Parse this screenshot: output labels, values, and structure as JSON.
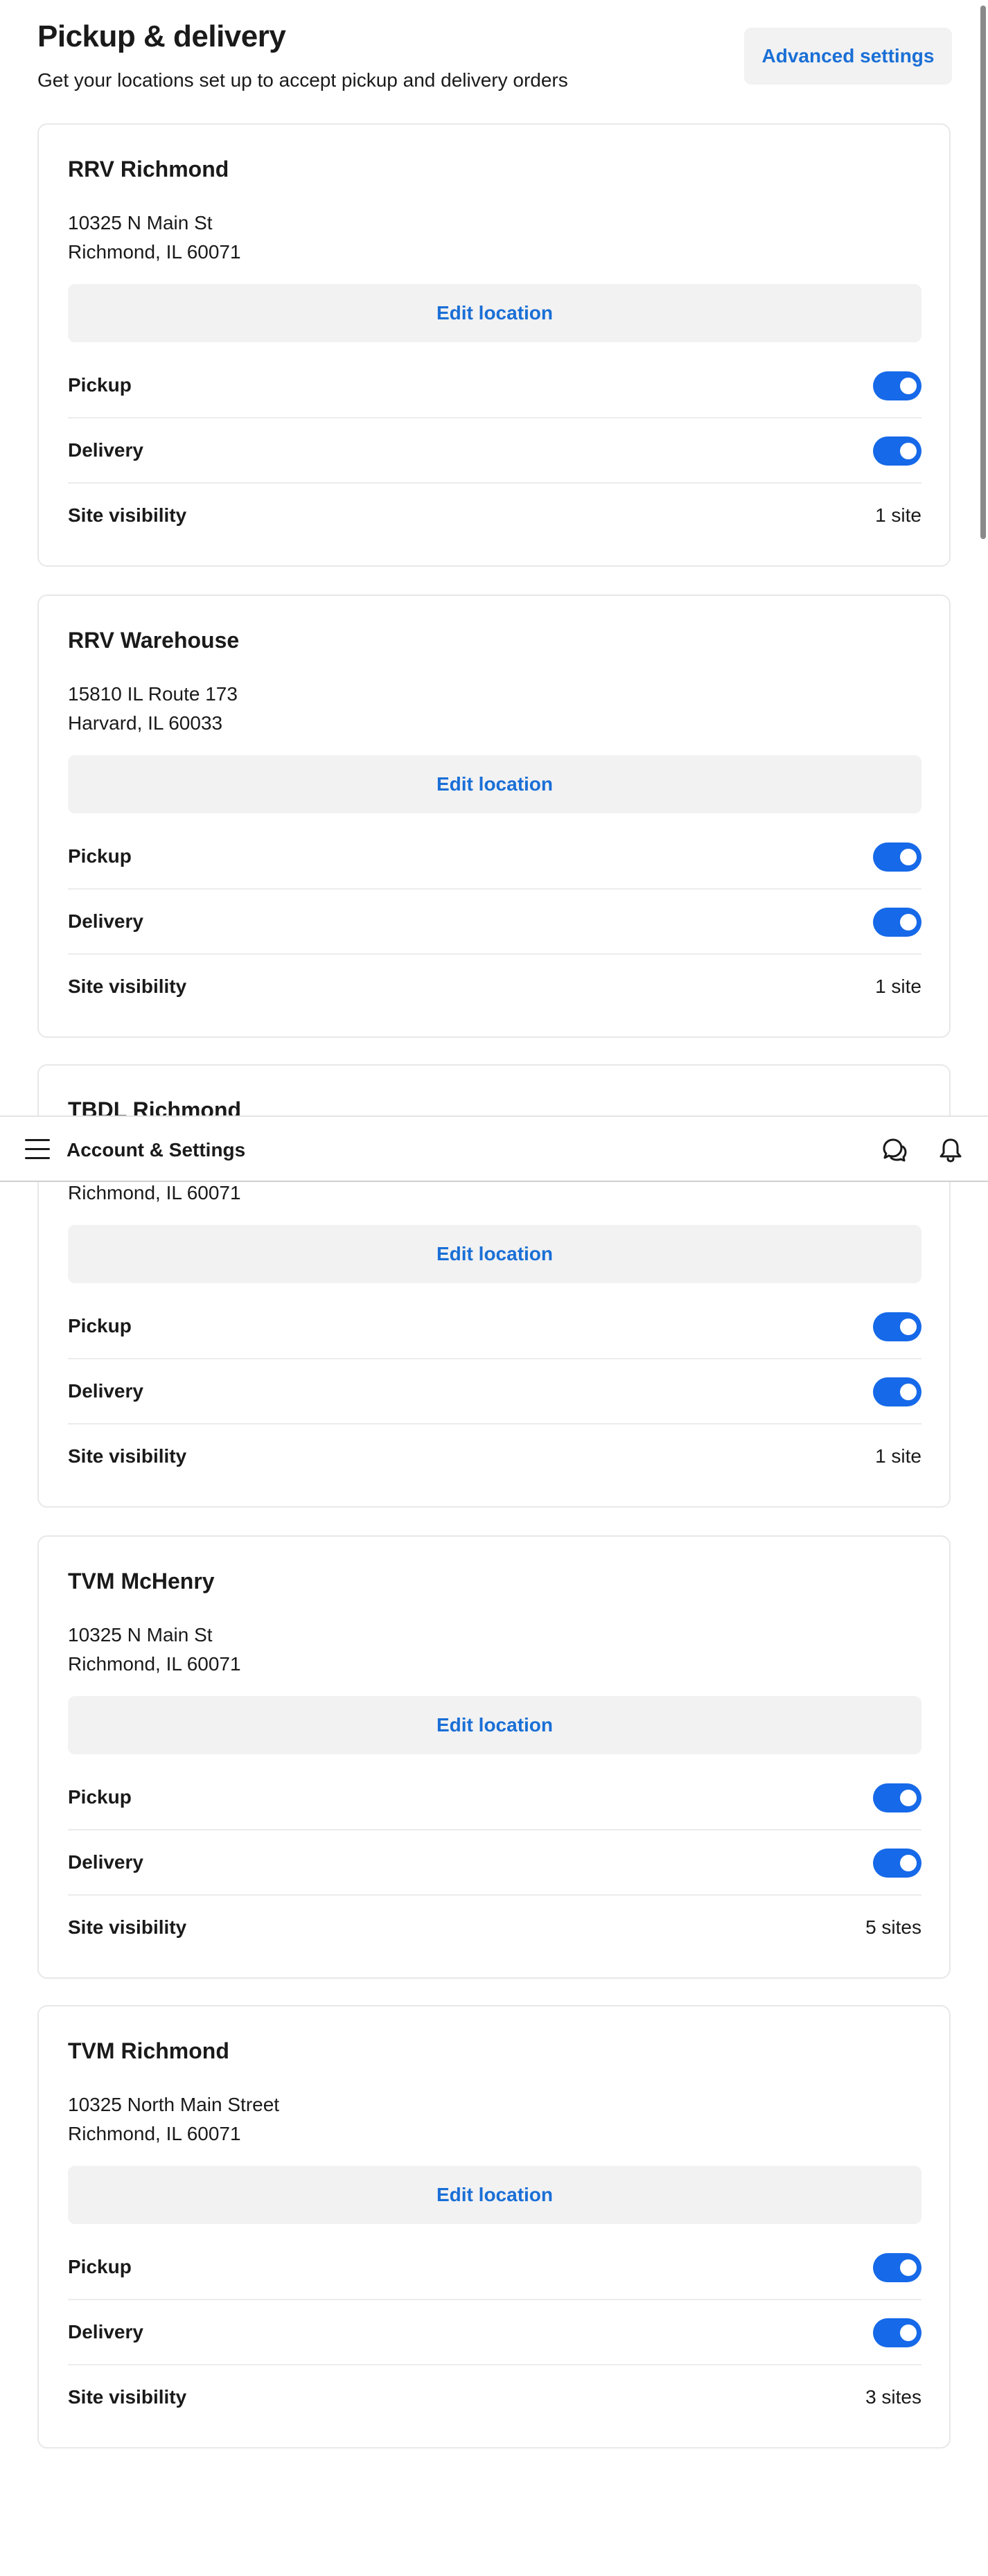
{
  "header": {
    "title": "Pickup & delivery",
    "subtitle": "Get your locations set up to accept pickup and delivery orders",
    "advanced_settings_label": "Advanced settings"
  },
  "labels": {
    "edit_location": "Edit location",
    "pickup": "Pickup",
    "delivery": "Delivery",
    "site_visibility": "Site visibility"
  },
  "locations": [
    {
      "name": "RRV Richmond",
      "address_line1": "10325 N Main St",
      "address_line2": "Richmond, IL 60071",
      "pickup_enabled": true,
      "delivery_enabled": true,
      "site_visibility": "1 site"
    },
    {
      "name": "RRV Warehouse",
      "address_line1": "15810 IL Route 173",
      "address_line2": "Harvard, IL 60033",
      "pickup_enabled": true,
      "delivery_enabled": true,
      "site_visibility": "1 site"
    },
    {
      "name": "TBDL Richmond",
      "address_line1": "",
      "address_line2": "Richmond, IL 60071",
      "pickup_enabled": true,
      "delivery_enabled": true,
      "site_visibility": "1 site"
    },
    {
      "name": "TVM McHenry",
      "address_line1": "10325 N Main St",
      "address_line2": "Richmond, IL 60071",
      "pickup_enabled": true,
      "delivery_enabled": true,
      "site_visibility": "5 sites"
    },
    {
      "name": "TVM Richmond",
      "address_line1": "10325 North Main Street",
      "address_line2": "Richmond, IL 60071",
      "pickup_enabled": true,
      "delivery_enabled": true,
      "site_visibility": "3 sites"
    }
  ],
  "navbar": {
    "title": "Account & Settings",
    "menu_icon": "hamburger-menu-icon",
    "chat_icon": "chat-bubbles-icon",
    "notification_icon": "bell-icon"
  },
  "colors": {
    "accent": "#1a6fd6",
    "toggle_on": "#1669e8",
    "button_bg": "#f2f2f2"
  }
}
